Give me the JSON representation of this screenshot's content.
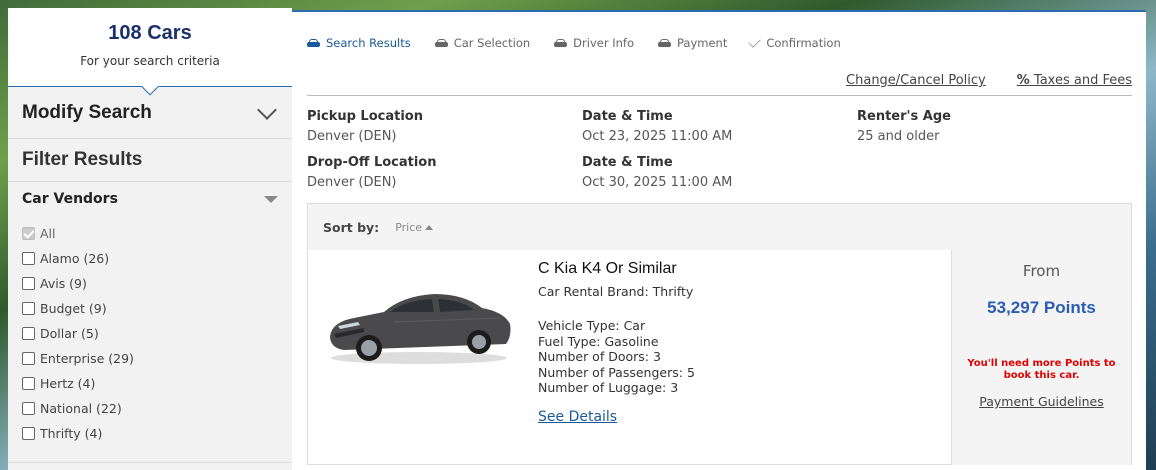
{
  "results": {
    "count": "108 Cars",
    "subtitle": "For your search criteria"
  },
  "modify_search": {
    "title": "Modify Search"
  },
  "filter": {
    "title": "Filter Results",
    "vendors_title": "Car Vendors",
    "vendors": [
      {
        "label": "All",
        "checked": true
      },
      {
        "label": "Alamo (26)",
        "checked": false
      },
      {
        "label": "Avis (9)",
        "checked": false
      },
      {
        "label": "Budget (9)",
        "checked": false
      },
      {
        "label": "Dollar (5)",
        "checked": false
      },
      {
        "label": "Enterprise (29)",
        "checked": false
      },
      {
        "label": "Hertz (4)",
        "checked": false
      },
      {
        "label": "National (22)",
        "checked": false
      },
      {
        "label": "Thrifty (4)",
        "checked": false
      }
    ]
  },
  "steps": [
    {
      "label": "Search Results",
      "icon": "car-icon",
      "active": true
    },
    {
      "label": "Car Selection",
      "icon": "car-icon",
      "active": false
    },
    {
      "label": "Driver Info",
      "icon": "car-icon",
      "active": false
    },
    {
      "label": "Payment",
      "icon": "car-icon",
      "active": false
    },
    {
      "label": "Confirmation",
      "icon": "check-icon",
      "active": false
    }
  ],
  "links": {
    "change_cancel": "Change/Cancel Policy",
    "taxes_symbol": "%",
    "taxes": "Taxes and Fees"
  },
  "trip": {
    "pickup_label": "Pickup Location",
    "pickup_value": "Denver (DEN)",
    "pickup_dt_label": "Date & Time",
    "pickup_dt_value": "Oct 23, 2025 11:00 AM",
    "age_label": "Renter's Age",
    "age_value": "25 and older",
    "dropoff_label": "Drop-Off Location",
    "dropoff_value": "Denver (DEN)",
    "dropoff_dt_label": "Date & Time",
    "dropoff_dt_value": "Oct 30, 2025 11:00 AM"
  },
  "sort": {
    "label": "Sort by:",
    "value": "Price"
  },
  "car": {
    "title": "C Kia K4 Or Similar",
    "brand": "Car Rental Brand: Thrifty",
    "vehicle_type": "Vehicle Type: Car",
    "fuel_type": "Fuel Type: Gasoline",
    "doors": "Number of Doors: 3",
    "passengers": "Number of Passengers: 5",
    "luggage": "Number of Luggage: 3",
    "see_details": "See Details",
    "from": "From",
    "points": "53,297 Points",
    "warning": "You'll need more Points to book this car.",
    "guidelines": "Payment Guidelines",
    "color": "#4a4a4c"
  },
  "colors": {
    "accent": "#2b6cb0",
    "title_navy": "#1b2f6b",
    "points_blue": "#2b5db5",
    "warning_red": "#e00000"
  }
}
